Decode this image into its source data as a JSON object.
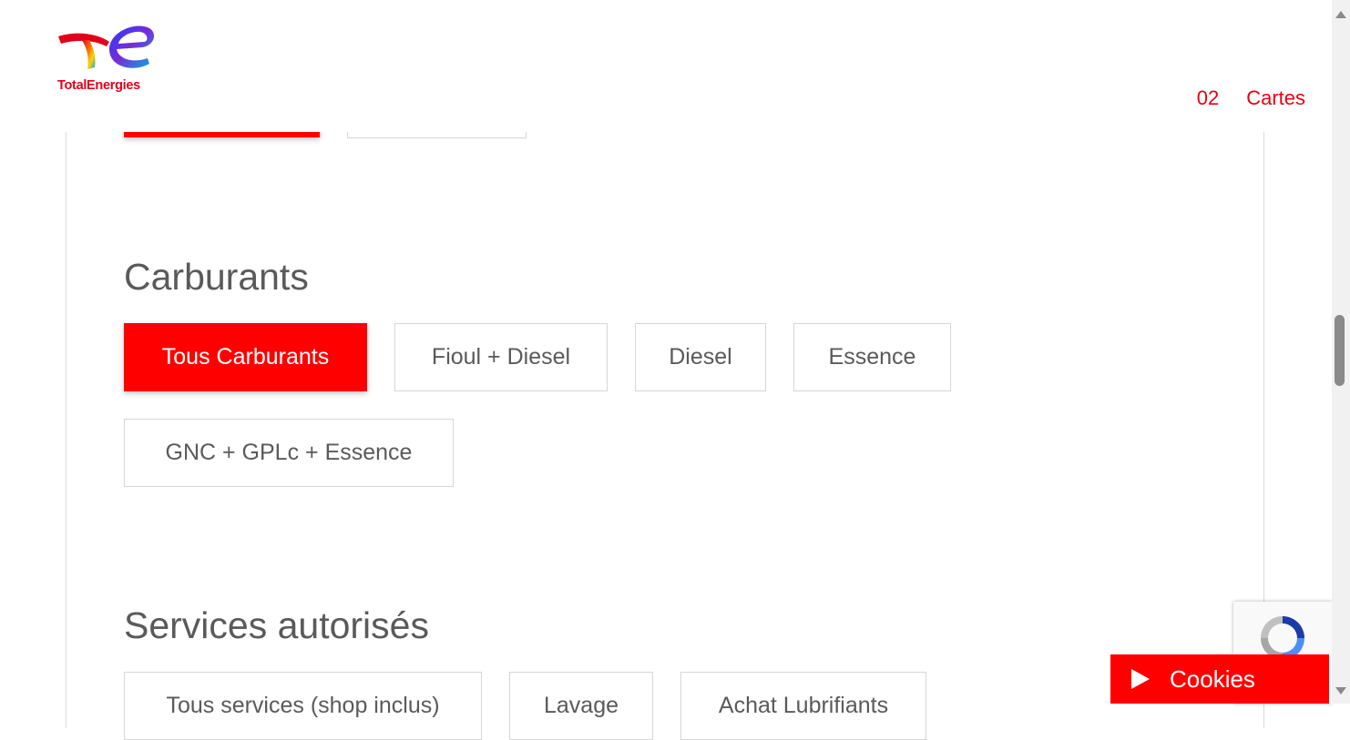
{
  "brand": {
    "name": "TotalEnergies"
  },
  "nav": {
    "items": [
      "02",
      "Cartes"
    ]
  },
  "sections": {
    "carburants": {
      "title": "Carburants",
      "options": [
        "Tous Carburants",
        "Fioul + Diesel",
        "Diesel",
        "Essence",
        "GNC + GPLc + Essence"
      ],
      "selected": "Tous Carburants"
    },
    "services": {
      "title": "Services autorisés",
      "options": [
        "Tous services (shop inclus)",
        "Lavage",
        "Achat Lubrifiants"
      ]
    }
  },
  "cookies": {
    "label": "Cookies"
  },
  "colors": {
    "accent": "#ff0000",
    "brand": "#e3001b"
  }
}
